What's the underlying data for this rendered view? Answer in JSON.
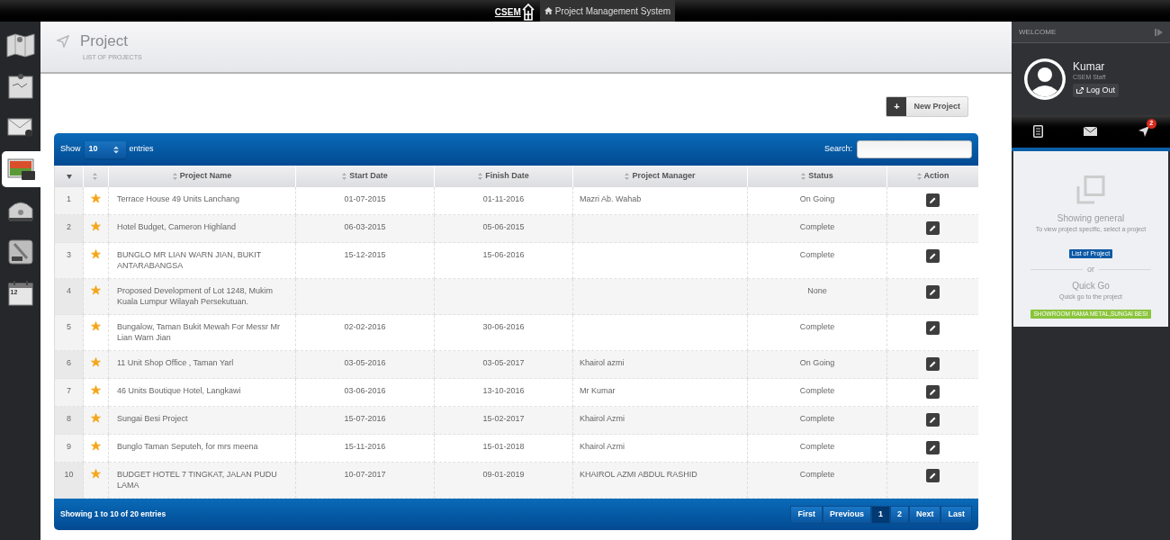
{
  "top_bar": {
    "logo": "CSEM",
    "title": "Project Management System"
  },
  "sidebar": {
    "items": [
      {
        "kind": "map",
        "selected": false
      },
      {
        "kind": "note",
        "selected": false
      },
      {
        "kind": "mail",
        "selected": false
      },
      {
        "kind": "photos",
        "selected": true
      },
      {
        "kind": "phone",
        "selected": false
      },
      {
        "kind": "tools",
        "selected": false
      },
      {
        "kind": "calendar",
        "selected": false,
        "day": "12"
      }
    ]
  },
  "header": {
    "title": "Project",
    "subtitle": "LIST OF PROJECTS"
  },
  "new_button": {
    "icon": "+",
    "label": "New Project"
  },
  "table": {
    "length": {
      "prefix": "Show",
      "value": "10",
      "suffix": "entries"
    },
    "search": {
      "label": "Search:"
    },
    "columns": [
      "Project Name",
      "Start Date",
      "Finish Date",
      "Project Manager",
      "Status",
      "Action"
    ],
    "rows": [
      {
        "no": "1",
        "starred": true,
        "name": "Terrace House 49 Units Lanchang",
        "start": "01-07-2015",
        "finish": "01-11-2016",
        "manager": "Mazri Ab. Wahab",
        "status": "On Going"
      },
      {
        "no": "2",
        "starred": true,
        "name": "Hotel Budget, Cameron Highland",
        "start": "06-03-2015",
        "finish": "05-06-2015",
        "status": "Complete"
      },
      {
        "no": "3",
        "starred": true,
        "name": "BUNGLO MR LIAN WARN JIAN, BUKIT ANTARABANGSA",
        "start": "15-12-2015",
        "finish": "15-06-2016",
        "status": "Complete"
      },
      {
        "no": "4",
        "starred": true,
        "name": "Proposed Development of Lot 1248, Mukim Kuala Lumpur Wilayah Persekutuan.",
        "status": "None"
      },
      {
        "no": "5",
        "starred": true,
        "name": "Bungalow, Taman Bukit Mewah For Messr Mr Lian Warn Jian",
        "start": "02-02-2016",
        "finish": "30-06-2016",
        "status": "Complete"
      },
      {
        "no": "6",
        "starred": true,
        "name": "11 Unit Shop Office , Taman Yarl",
        "start": "03-05-2016",
        "finish": "03-05-2017",
        "manager": "Khairol azmi",
        "status": "On Going"
      },
      {
        "no": "7",
        "starred": true,
        "name": "46 Units Boutique Hotel, Langkawi",
        "start": "03-06-2016",
        "finish": "13-10-2016",
        "manager": "Mr Kumar",
        "status": "Complete"
      },
      {
        "no": "8",
        "starred": true,
        "name": "Sungai Besi Project",
        "start": "15-07-2016",
        "finish": "15-02-2017",
        "manager": "Khairol Azmi",
        "status": "Complete"
      },
      {
        "no": "9",
        "starred": true,
        "name": "Bunglo Taman Seputeh, for mrs meena",
        "start": "15-11-2016",
        "finish": "15-01-2018",
        "manager": "Khairol Azmi",
        "status": "Complete"
      },
      {
        "no": "10",
        "starred": true,
        "name": "BUDGET HOTEL 7 TINGKAT, JALAN PUDU LAMA",
        "start": "10-07-2017",
        "finish": "09-01-2019",
        "manager": "KHAIROL AZMI ABDUL RASHID",
        "status": "Complete"
      }
    ],
    "info": "Showing 1 to 10 of 20 entries",
    "pagination": [
      {
        "label": "First",
        "selected": false
      },
      {
        "label": "Previous",
        "selected": false
      },
      {
        "label": "1",
        "selected": true
      },
      {
        "label": "2",
        "selected": false
      },
      {
        "label": "Next",
        "selected": false
      },
      {
        "label": "Last",
        "selected": false
      }
    ]
  },
  "right_panel": {
    "heading": "WELCOME",
    "user": {
      "name": "Kumar",
      "role": "CSEM Staff",
      "logout": "Log Out"
    },
    "tabs": [
      {
        "kind": "document"
      },
      {
        "kind": "mail"
      },
      {
        "kind": "navigate",
        "badge": "2"
      }
    ],
    "info": {
      "title": "Showing general",
      "hint": "To view project specific, select a project",
      "list_button": "List of Project",
      "or": "or",
      "quick_title": "Quick Go",
      "quick_hint": "Quick go to the project",
      "quick_project": "SHOWROOM RAMA METAL,SUNGAI BESI"
    }
  }
}
